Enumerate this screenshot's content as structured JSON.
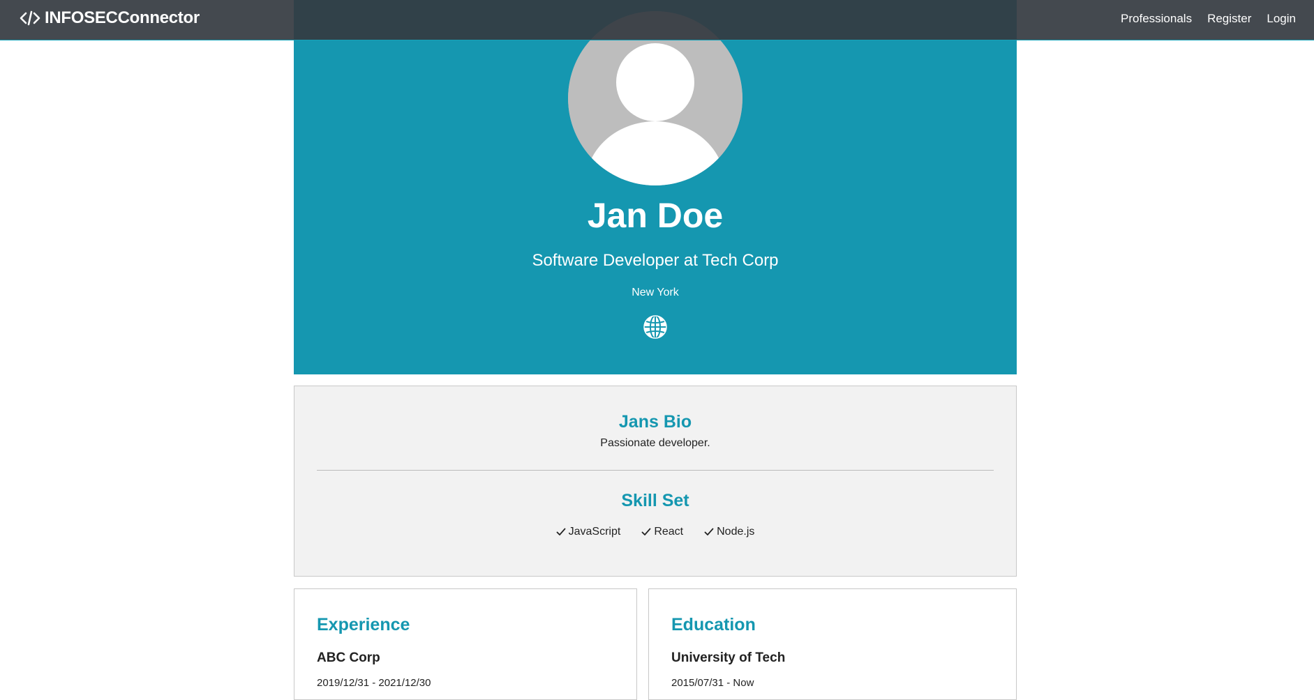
{
  "navbar": {
    "brand": "INFOSECConnector",
    "brand_icon": "code-icon",
    "links": [
      {
        "label": "Professionals"
      },
      {
        "label": "Register"
      },
      {
        "label": "Login"
      }
    ]
  },
  "profile": {
    "name": "Jan Doe",
    "headline": "Software Developer at Tech Corp",
    "location": "New York",
    "website_icon": "globe-icon",
    "avatar_icon": "user-placeholder-icon"
  },
  "bio": {
    "title": "Jans Bio",
    "text": "Passionate developer."
  },
  "skills": {
    "title": "Skill Set",
    "items": [
      {
        "label": "JavaScript"
      },
      {
        "label": "React"
      },
      {
        "label": "Node.js"
      }
    ]
  },
  "experience": {
    "title": "Experience",
    "entries": [
      {
        "company": "ABC Corp",
        "dates": "2019/12/31 - 2021/12/30"
      }
    ]
  },
  "education": {
    "title": "Education",
    "entries": [
      {
        "school": "University of Tech",
        "dates": "2015/07/31 - Now"
      }
    ]
  },
  "colors": {
    "accent": "#1597b0",
    "navbar": "#343a40",
    "card_bg": "#f2f2f2"
  }
}
